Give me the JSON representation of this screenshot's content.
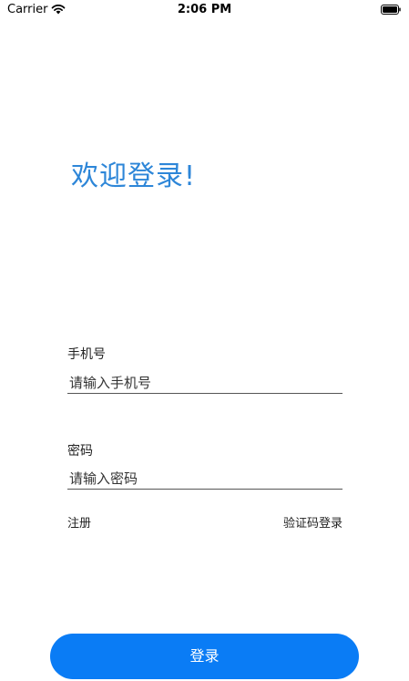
{
  "status_bar": {
    "carrier": "Carrier",
    "time": "2:06 PM",
    "wifi_icon": "wifi-icon",
    "battery_icon": "battery-icon"
  },
  "welcome_title": "欢迎登录!",
  "phone": {
    "label": "手机号",
    "placeholder": "请输入手机号",
    "value": ""
  },
  "password": {
    "label": "密码",
    "placeholder": "请输入密码",
    "value": ""
  },
  "links": {
    "register": "注册",
    "code_login": "验证码登录"
  },
  "login_button": "登录",
  "colors": {
    "accent": "#0a7cf5",
    "title": "#2d86d8"
  }
}
